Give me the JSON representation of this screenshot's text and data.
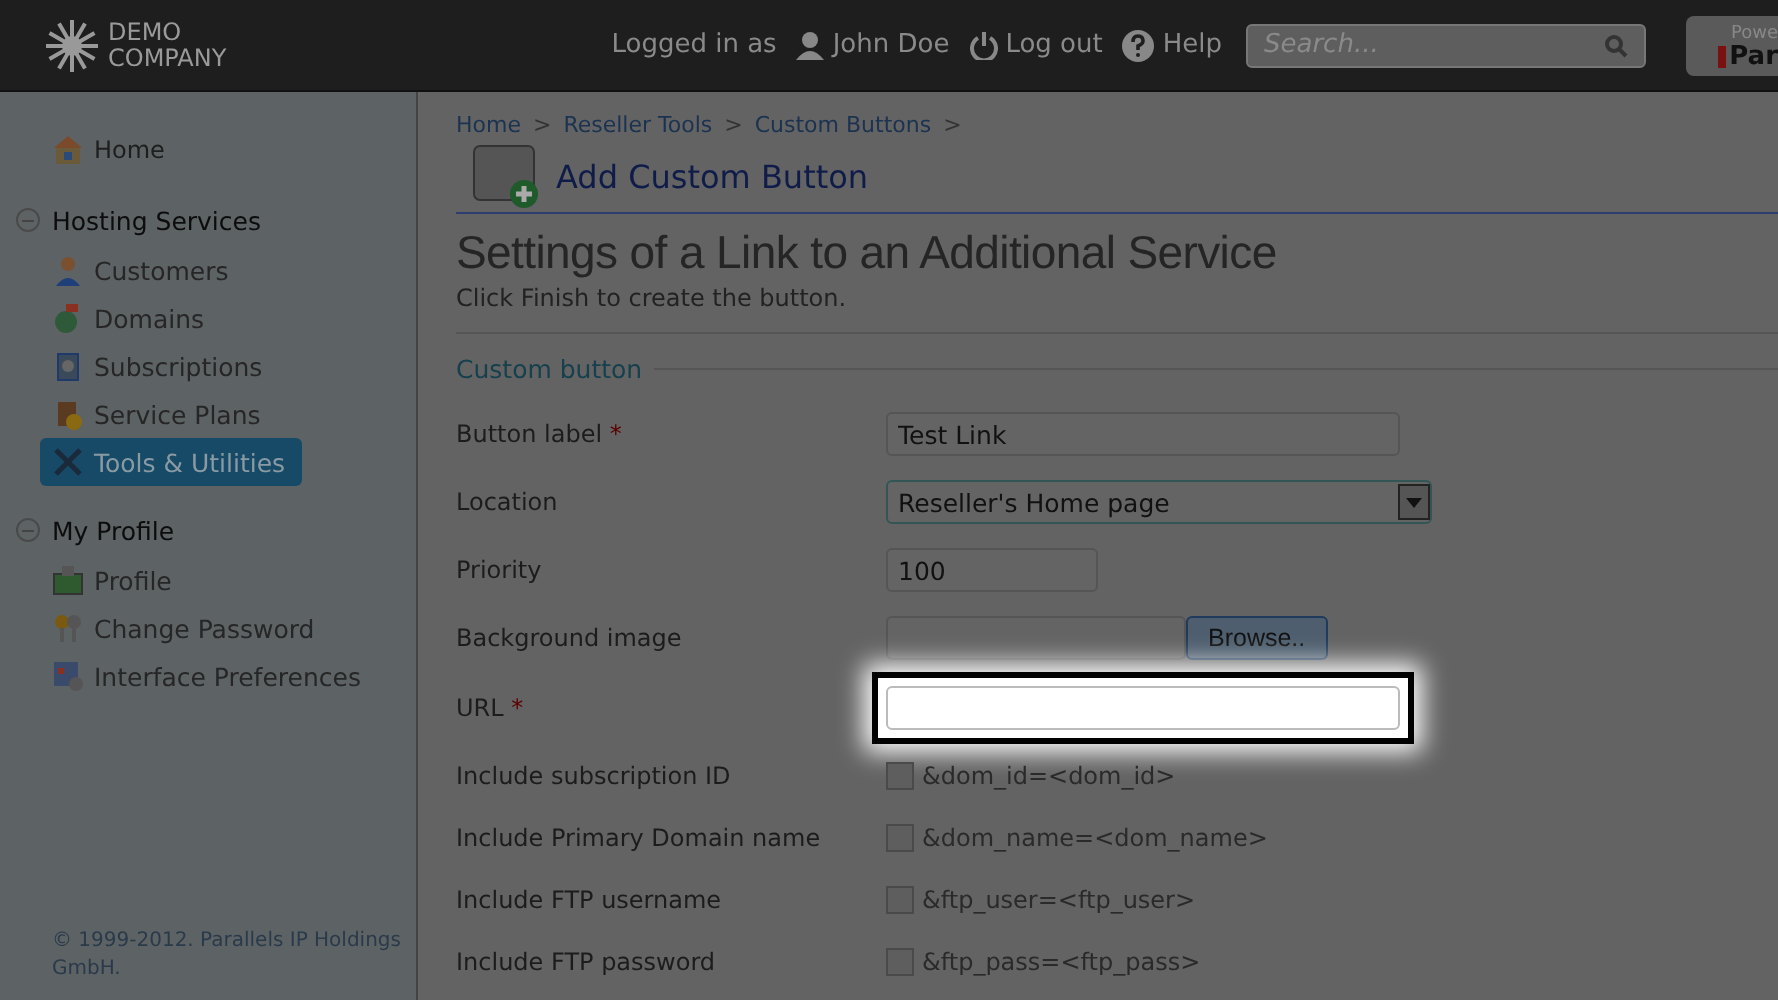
{
  "header": {
    "logo": [
      "DEMO",
      "COMPANY"
    ],
    "logged_in_label": "Logged in as",
    "user": "John Doe",
    "logout": "Log out",
    "help": "Help",
    "search": {
      "placeholder": "Search..."
    },
    "powered": {
      "caption": "Powe",
      "brand": "Par"
    }
  },
  "sidebar": {
    "home": {
      "label": "Home"
    },
    "groups": [
      {
        "title": "Hosting Services",
        "expanded": true,
        "items": [
          {
            "label": "Customers",
            "selected": false
          },
          {
            "label": "Domains",
            "selected": false
          },
          {
            "label": "Subscriptions",
            "selected": false
          },
          {
            "label": "Service Plans",
            "selected": false
          },
          {
            "label": "Tools & Utilities",
            "selected": true
          }
        ]
      },
      {
        "title": "My Profile",
        "expanded": true,
        "items": [
          {
            "label": "Profile",
            "selected": false
          },
          {
            "label": "Change Password",
            "selected": false
          },
          {
            "label": "Interface Preferences",
            "selected": false
          }
        ]
      }
    ],
    "footer": "© 1999-2012. Parallels IP Holdings GmbH."
  },
  "breadcrumbs": [
    "Home",
    "Reseller Tools",
    "Custom Buttons"
  ],
  "breadcrumb_separator": ">",
  "required_mark": "*",
  "page_title": "Add Custom Button",
  "heading": "Settings of a Link to an Additional Service",
  "hint": "Click Finish to create the button.",
  "section": "Custom button",
  "fields": [
    {
      "kind": "text",
      "label": "Button label",
      "required": true,
      "value": "Test Link"
    },
    {
      "kind": "select",
      "label": "Location",
      "required": false,
      "value": "Reseller's Home page"
    },
    {
      "kind": "short",
      "label": "Priority",
      "required": false,
      "value": "100"
    },
    {
      "kind": "file",
      "label": "Background image",
      "required": false,
      "button": "Browse.."
    },
    {
      "kind": "text",
      "label": "URL",
      "required": true,
      "highlighted": true
    },
    {
      "kind": "checkbox",
      "label": "Include subscription ID",
      "checked": false,
      "text": "&dom_id=<dom_id>"
    },
    {
      "kind": "checkbox",
      "label": "Include Primary Domain name",
      "checked": false,
      "text": "&dom_name=<dom_name>"
    },
    {
      "kind": "checkbox",
      "label": "Include FTP username",
      "checked": false,
      "text": "&ftp_user=<ftp_user>"
    },
    {
      "kind": "checkbox",
      "label": "Include FTP password",
      "checked": false,
      "text": "&ftp_pass=<ftp_pass>"
    }
  ]
}
